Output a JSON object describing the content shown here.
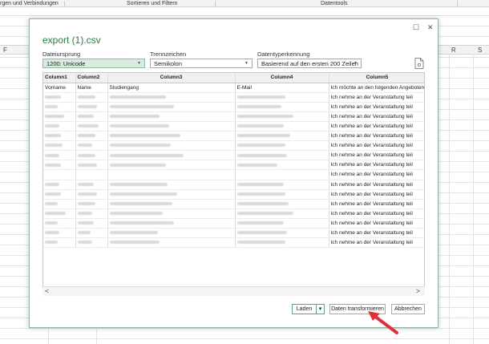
{
  "ribbon": {
    "groups": [
      "rgen und Verbindungen",
      "Sortieren und Filtern",
      "Datentools"
    ]
  },
  "sheet": {
    "column_headers": [
      "F",
      "R",
      "S"
    ]
  },
  "dialog": {
    "title": "export (1).csv",
    "window_buttons": {
      "maximize": "☐",
      "close": "✕"
    },
    "file_origin": {
      "label": "Dateiursprung",
      "value": "1200: Unicode"
    },
    "delimiter": {
      "label": "Trennzeichen",
      "value": "Semikolon"
    },
    "type_detection": {
      "label": "Datentyperkennung",
      "value": "Basierend auf den ersten 200 Zeilen"
    },
    "table": {
      "columns": [
        "Column1",
        "Column2",
        "Column3",
        "Column4",
        "Column5"
      ],
      "first_row": [
        "Vorname",
        "Name",
        "Studiengang",
        "E-Mail",
        "Ich möchte an den folgenden Angeboten teiln"
      ],
      "col5_values": [
        "Ich nehme an der Veranstaltung teil",
        "Ich nehme an der Veranstaltung teil",
        "Ich nehme an der Veranstaltung teil",
        "Ich nehme an der Veranstaltung teil",
        "Ich nehme an der Veranstaltung teil",
        "Ich nehme an der Veranstaltung teil",
        "Ich nehme an der Veranstaltung teil",
        "Ich nehme an der Veranstaltung teil",
        "Ich nehme an der Veranstaltung teil",
        "Ich nehme an der Veranstaltung teil",
        "Ich nehme an der Veranstaltung teil",
        "Ich nehme an der Veranstaltung teil",
        "Ich nehme an der Veranstaltung teil",
        "Ich nehme an der Veranstaltung teil",
        "Ich nehme an der Veranstaltung teil",
        "Ich nehme an der Veranstaltung teil"
      ],
      "scroll_left": "<",
      "scroll_right": ">"
    },
    "buttons": {
      "load": "Laden",
      "load_dropdown": "▾",
      "transform": "Daten transformieren",
      "cancel": "Abbrechen"
    }
  },
  "colors": {
    "accent": "#2b7a4b",
    "active_select": "#d7ecde",
    "annotation_arrow": "#e0303a"
  }
}
